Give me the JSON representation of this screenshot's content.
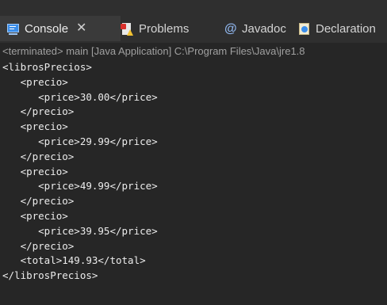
{
  "tabs": [
    {
      "label": "Console",
      "icon": "console-icon",
      "active": true,
      "closable": true
    },
    {
      "label": "Problems",
      "icon": "problems-icon",
      "active": false
    },
    {
      "label": "Javadoc",
      "icon": "javadoc-icon",
      "active": false
    },
    {
      "label": "Declaration",
      "icon": "declaration-icon",
      "active": false
    }
  ],
  "close_glyph": "✕",
  "javadoc_glyph": "@",
  "status": "<terminated> main [Java Application] C:\\Program Files\\Java\\jre1.8",
  "output_lines": [
    "<librosPrecios>",
    "   <precio>",
    "      <price>30.00</price>",
    "   </precio>",
    "   <precio>",
    "      <price>29.99</price>",
    "   </precio>",
    "   <precio>",
    "      <price>49.99</price>",
    "   </precio>",
    "   <precio>",
    "      <price>39.95</price>",
    "   </precio>",
    "   <total>149.93</total>",
    "</librosPrecios>"
  ],
  "colors": {
    "background": "#262626",
    "tabbar": "#2f2f2f",
    "active_tab": "#3a3a3a",
    "text": "#ececec",
    "status_text": "#a0a0a0"
  }
}
